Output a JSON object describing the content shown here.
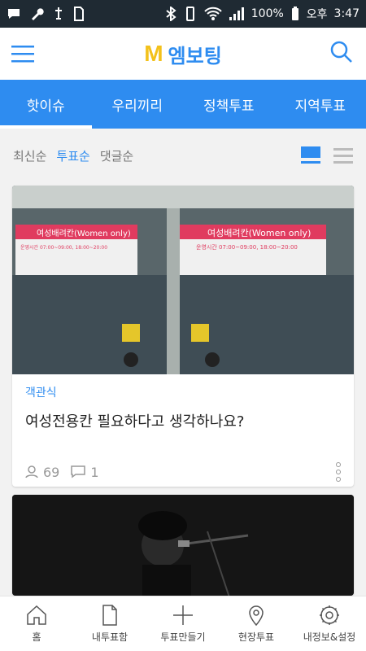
{
  "status": {
    "battery": "100%",
    "ampm": "오후",
    "time": "3:47"
  },
  "brand": {
    "mark": "M",
    "name": "엠보팅"
  },
  "tabs": [
    {
      "label": "핫이슈"
    },
    {
      "label": "우리끼리"
    },
    {
      "label": "정책투표"
    },
    {
      "label": "지역투표"
    }
  ],
  "sort": {
    "options": [
      {
        "label": "최신순"
      },
      {
        "label": "투표순"
      },
      {
        "label": "댓글순"
      }
    ],
    "active": "투표순"
  },
  "cards": [
    {
      "category": "객관식",
      "title": "여성전용칸 필요하다고 생각하나요?",
      "participants": "69",
      "comments": "1",
      "image_signs": {
        "main": "여성배려칸(Women only)",
        "sub": "운영시간 07:00~09:00, 18:00~20:00"
      }
    }
  ],
  "nav": [
    {
      "label": "홈",
      "icon": "home-icon"
    },
    {
      "label": "내투표함",
      "icon": "document-icon"
    },
    {
      "label": "투표만들기",
      "icon": "plus-icon"
    },
    {
      "label": "현장투표",
      "icon": "location-pin-icon"
    },
    {
      "label": "내정보&설정",
      "icon": "settings-gear-icon"
    }
  ],
  "colors": {
    "primary": "#2e8cf0",
    "brand_yellow": "#f3c11b",
    "status_bar": "#1f2a33"
  }
}
